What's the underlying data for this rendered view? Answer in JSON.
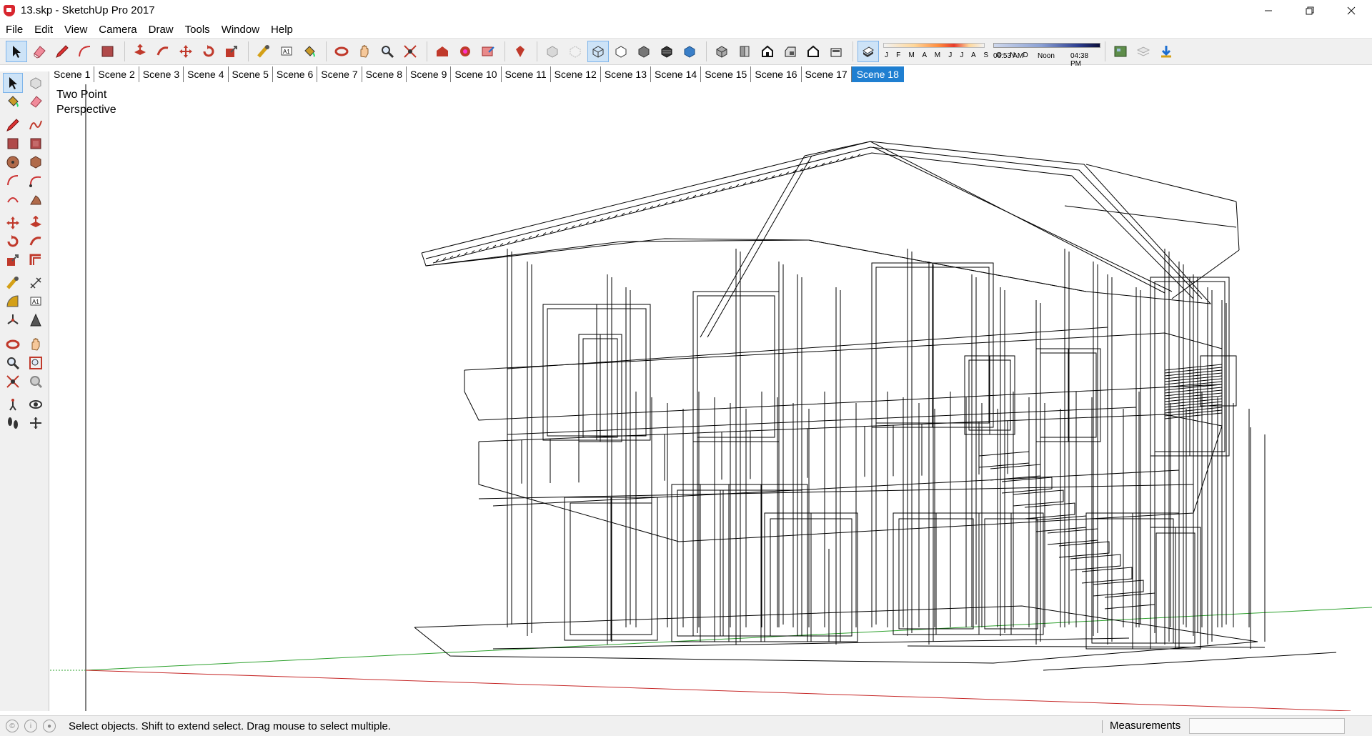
{
  "window": {
    "title": "13.skp - SketchUp Pro 2017",
    "controls": [
      "minimize",
      "restore",
      "close"
    ]
  },
  "menu": [
    "File",
    "Edit",
    "View",
    "Camera",
    "Draw",
    "Tools",
    "Window",
    "Help"
  ],
  "toolbar": {
    "groups": [
      [
        "select-icon",
        "eraser-icon",
        "pencil-line-icon",
        "arc-icon",
        "rectangle-icon"
      ],
      [
        "push-pull-icon",
        "follow-me-icon",
        "move-icon",
        "rotate-icon",
        "scale-icon"
      ],
      [
        "tape-measure-icon",
        "text-icon",
        "paint-bucket-icon"
      ],
      [
        "orbit-icon",
        "pan-icon",
        "zoom-icon",
        "zoom-extents-icon"
      ],
      [
        "warehouse-icon",
        "extension-icon",
        "send-to-layout-icon"
      ],
      [
        "ruby-icon"
      ],
      [
        "xray-icon",
        "back-edges-icon",
        "wireframe-icon",
        "hidden-line-icon",
        "shaded-icon",
        "textured-icon",
        "monochrome-icon"
      ],
      [
        "iso-view-icon",
        "top-view-icon",
        "front-view-icon",
        "right-view-icon",
        "back-view-icon",
        "left-view-icon"
      ],
      [
        "shadows-toggle-icon"
      ]
    ],
    "shadow": {
      "months": "J F M A M J J A S O N D",
      "time_start": "06:53 AM",
      "time_noon": "Noon",
      "time_end": "04:38 PM"
    },
    "trailing": [
      "geo-location-icon",
      "layers-icon",
      "download-icon"
    ]
  },
  "scenes": {
    "tabs": [
      "Scene 1",
      "Scene 2",
      "Scene 3",
      "Scene 4",
      "Scene 5",
      "Scene 6",
      "Scene 7",
      "Scene 8",
      "Scene 9",
      "Scene 10",
      "Scene 11",
      "Scene 12",
      "Scene 13",
      "Scene 14",
      "Scene 15",
      "Scene 16",
      "Scene 17",
      "Scene 18"
    ],
    "active": "Scene 18"
  },
  "palette": [
    [
      "select-icon",
      "component-icon"
    ],
    [
      "paint-bucket-icon",
      "eraser-icon"
    ],
    [
      "pencil-line-icon",
      "freehand-icon"
    ],
    [
      "rectangle-icon",
      "rotated-rectangle-icon"
    ],
    [
      "circle-icon",
      "polygon-icon"
    ],
    [
      "arc-icon",
      "two-point-arc-icon"
    ],
    [
      "three-point-arc-icon",
      "pie-icon"
    ],
    [
      "move-icon",
      "push-pull-icon"
    ],
    [
      "rotate-icon",
      "follow-me-icon"
    ],
    [
      "scale-icon",
      "offset-icon"
    ],
    [
      "tape-measure-icon",
      "dimension-icon"
    ],
    [
      "protractor-icon",
      "text-icon"
    ],
    [
      "axes-icon",
      "3d-text-icon"
    ],
    [
      "orbit-icon",
      "pan-icon"
    ],
    [
      "zoom-icon",
      "zoom-window-icon"
    ],
    [
      "zoom-extents-icon",
      "previous-view-icon"
    ],
    [
      "position-camera-icon",
      "look-around-icon"
    ],
    [
      "walk-icon",
      "section-plane-icon"
    ]
  ],
  "viewport": {
    "camera_label_line1": "Two Point",
    "camera_label_line2": "Perspective"
  },
  "status": {
    "message": "Select objects. Shift to extend select. Drag mouse to select multiple.",
    "measurements_label": "Measurements",
    "measurements_value": ""
  },
  "colors": {
    "active_tab": "#1f7fd1",
    "toolbar_bg": "#f0f0f0",
    "axis_green": "#2ea12e",
    "axis_red": "#c62828",
    "edge": "#000000"
  }
}
